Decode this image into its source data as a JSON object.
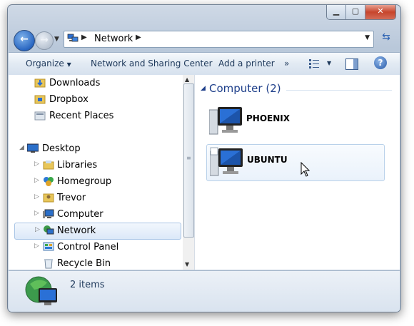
{
  "address_bar": {
    "breadcrumb": [
      "Network"
    ]
  },
  "command_bar": {
    "organize": "Organize",
    "network_sharing": "Network and Sharing Center",
    "add_printer": "Add a printer",
    "more": "»"
  },
  "nav_pane": {
    "favorites": [
      {
        "label": "Downloads",
        "icon": "downloads-folder-icon"
      },
      {
        "label": "Dropbox",
        "icon": "dropbox-folder-icon"
      },
      {
        "label": "Recent Places",
        "icon": "recent-places-icon"
      }
    ],
    "desktop": {
      "label": "Desktop",
      "icon": "desktop-icon"
    },
    "desktop_children": [
      {
        "label": "Libraries",
        "icon": "libraries-icon"
      },
      {
        "label": "Homegroup",
        "icon": "homegroup-icon"
      },
      {
        "label": "Trevor",
        "icon": "user-folder-icon"
      },
      {
        "label": "Computer",
        "icon": "computer-icon"
      },
      {
        "label": "Network",
        "icon": "network-icon",
        "selected": true
      },
      {
        "label": "Control Panel",
        "icon": "control-panel-icon"
      },
      {
        "label": "Recycle Bin",
        "icon": "recycle-bin-icon"
      }
    ]
  },
  "content": {
    "group_title": "Computer (2)",
    "computers": [
      {
        "name": "PHOENIX"
      },
      {
        "name": "UBUNTU",
        "hover": true
      }
    ]
  },
  "status_bar": {
    "item_count": "2 items"
  },
  "colors": {
    "accent": "#1e3f8a",
    "selection": "#dbe8f8"
  }
}
